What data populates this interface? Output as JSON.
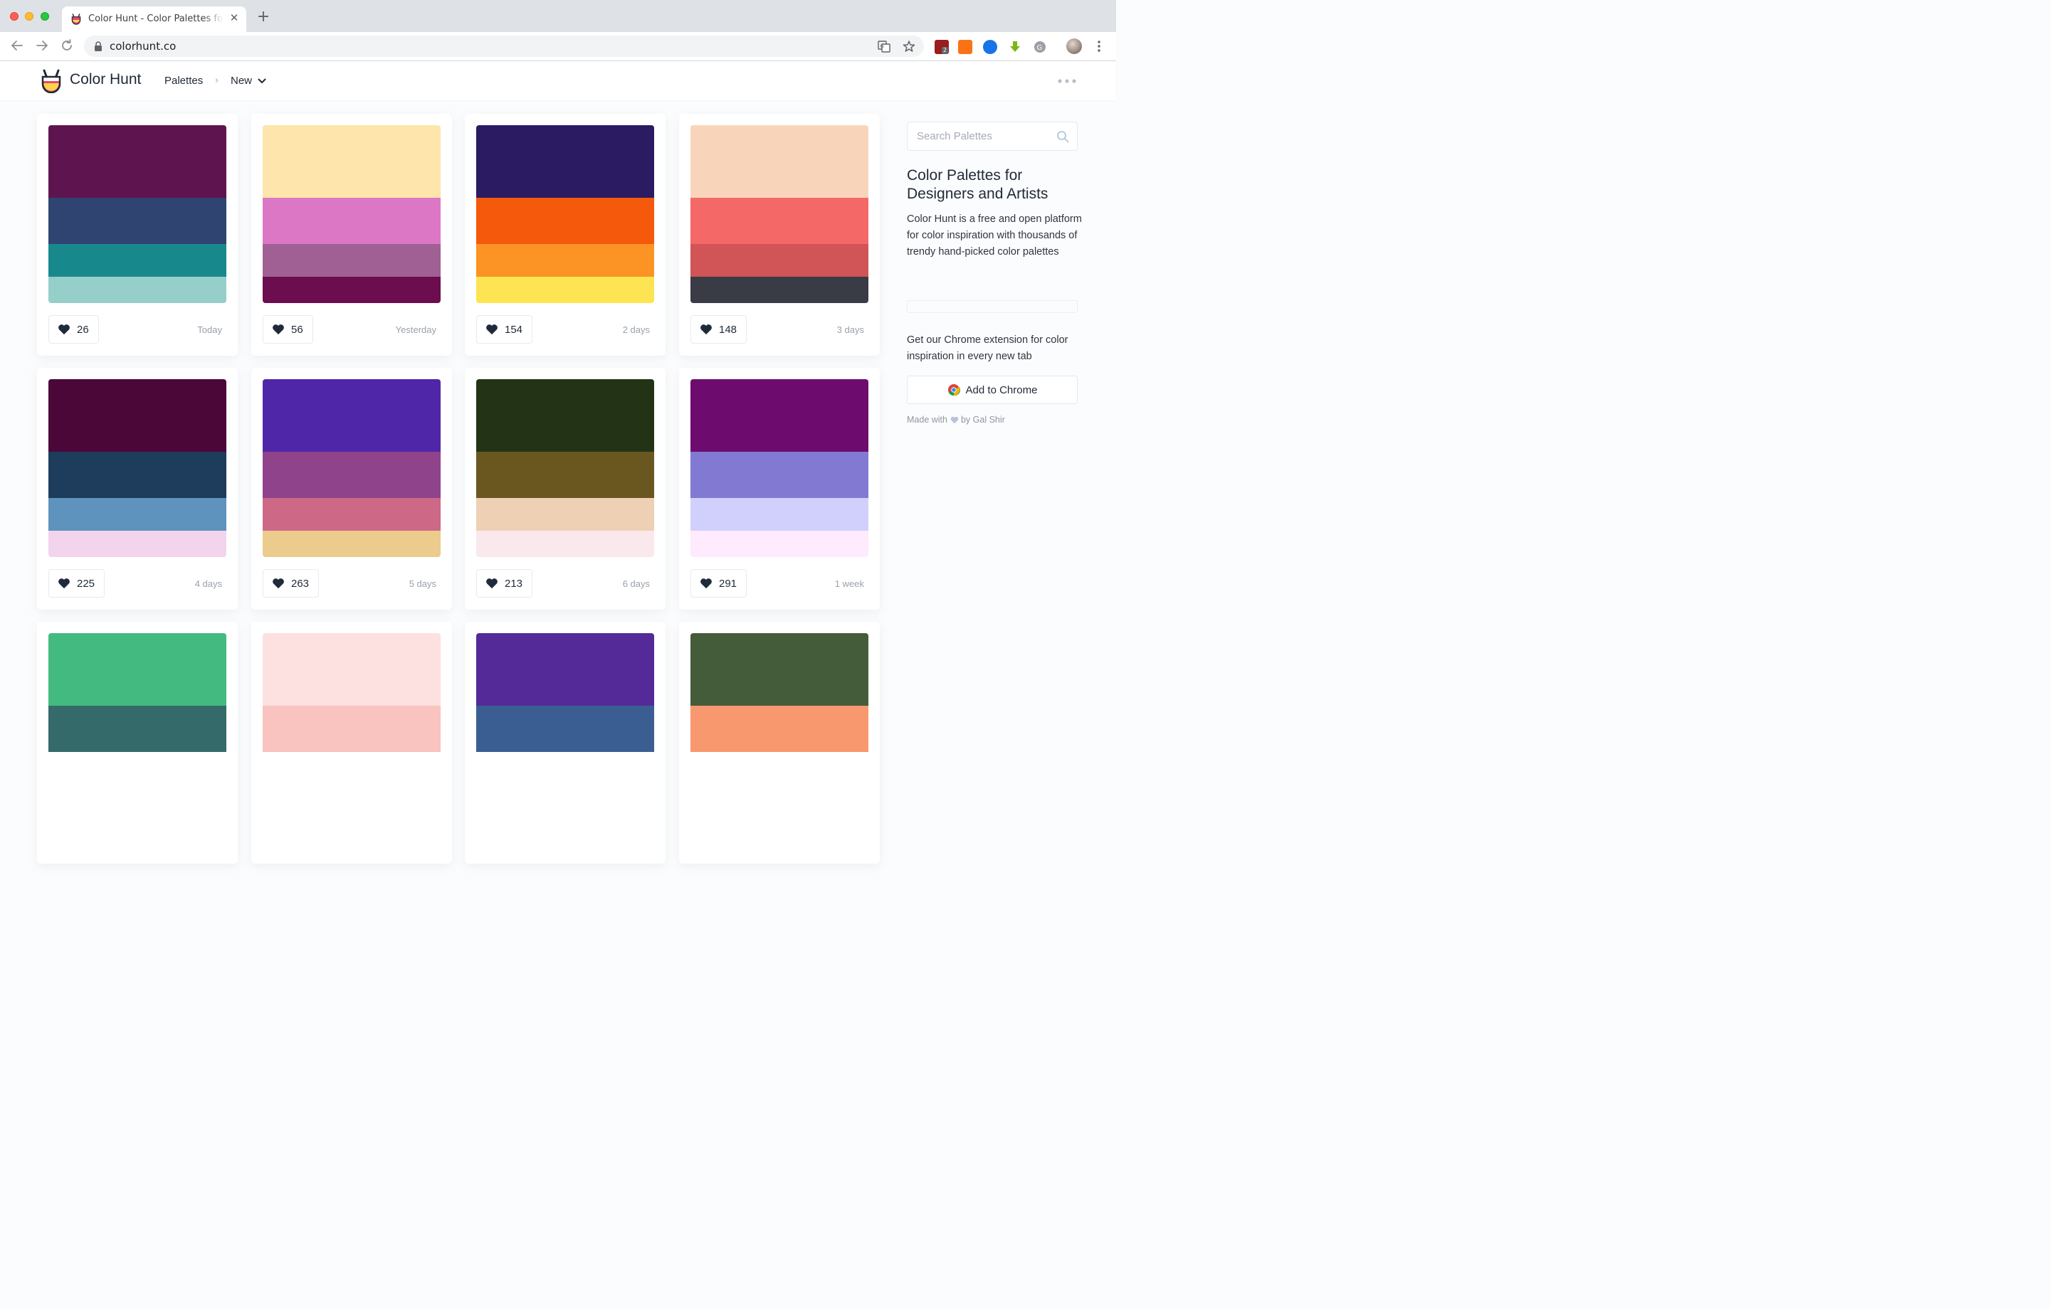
{
  "browser": {
    "tab_title": "Color Hunt - Color Palettes for Designers and Artists",
    "url": "colorhunt.co",
    "extension_badge": "2"
  },
  "site": {
    "logo_text": "Color Hunt",
    "breadcrumb_palettes": "Palettes",
    "breadcrumb_separator": "›",
    "breadcrumb_current": "New"
  },
  "palettes": [
    {
      "likes": "26",
      "date": "Today",
      "colors": [
        "#5e154f",
        "#2f4470",
        "#17898c",
        "#96ceca"
      ]
    },
    {
      "likes": "56",
      "date": "Yesterday",
      "colors": [
        "#fee5ab",
        "#dc77c5",
        "#a16093",
        "#6b0d4e"
      ]
    },
    {
      "likes": "154",
      "date": "2 days",
      "colors": [
        "#2b1b62",
        "#f5590b",
        "#fb9424",
        "#fde453"
      ]
    },
    {
      "likes": "148",
      "date": "3 days",
      "colors": [
        "#f8d5ba",
        "#f56868",
        "#d15456",
        "#393b45"
      ]
    },
    {
      "likes": "225",
      "date": "4 days",
      "colors": [
        "#4a0737",
        "#1e3c5b",
        "#5d93bd",
        "#f2d4ed"
      ]
    },
    {
      "likes": "263",
      "date": "5 days",
      "colors": [
        "#5026a8",
        "#8f438a",
        "#cd6887",
        "#ebcc8d"
      ]
    },
    {
      "likes": "213",
      "date": "6 days",
      "colors": [
        "#233416",
        "#6a5720",
        "#eed0b5",
        "#f9e9ec"
      ]
    },
    {
      "likes": "291",
      "date": "1 week",
      "colors": [
        "#6e0b6f",
        "#8279d3",
        "#d1d0fc",
        "#ffeafe"
      ]
    },
    {
      "likes": "",
      "date": "",
      "colors": [
        "#43ba80",
        "#356a6a"
      ]
    },
    {
      "likes": "",
      "date": "",
      "colors": [
        "#fde0e0",
        "#f9c3bf"
      ]
    },
    {
      "likes": "",
      "date": "",
      "colors": [
        "#532a97",
        "#3a5e92"
      ]
    },
    {
      "likes": "",
      "date": "",
      "colors": [
        "#455c3b",
        "#f8986e"
      ]
    }
  ],
  "sidebar": {
    "search_placeholder": "Search Palettes",
    "title": "Color Palettes for Designers and Artists",
    "description": "Color Hunt is a free and open platform for color inspiration with thousands of trendy hand-picked color palettes",
    "extension_text": "Get our Chrome extension for color inspiration in every new tab",
    "add_to_chrome": "Add to Chrome",
    "made_with": "Made with",
    "by_author": "by Gal Shir"
  }
}
